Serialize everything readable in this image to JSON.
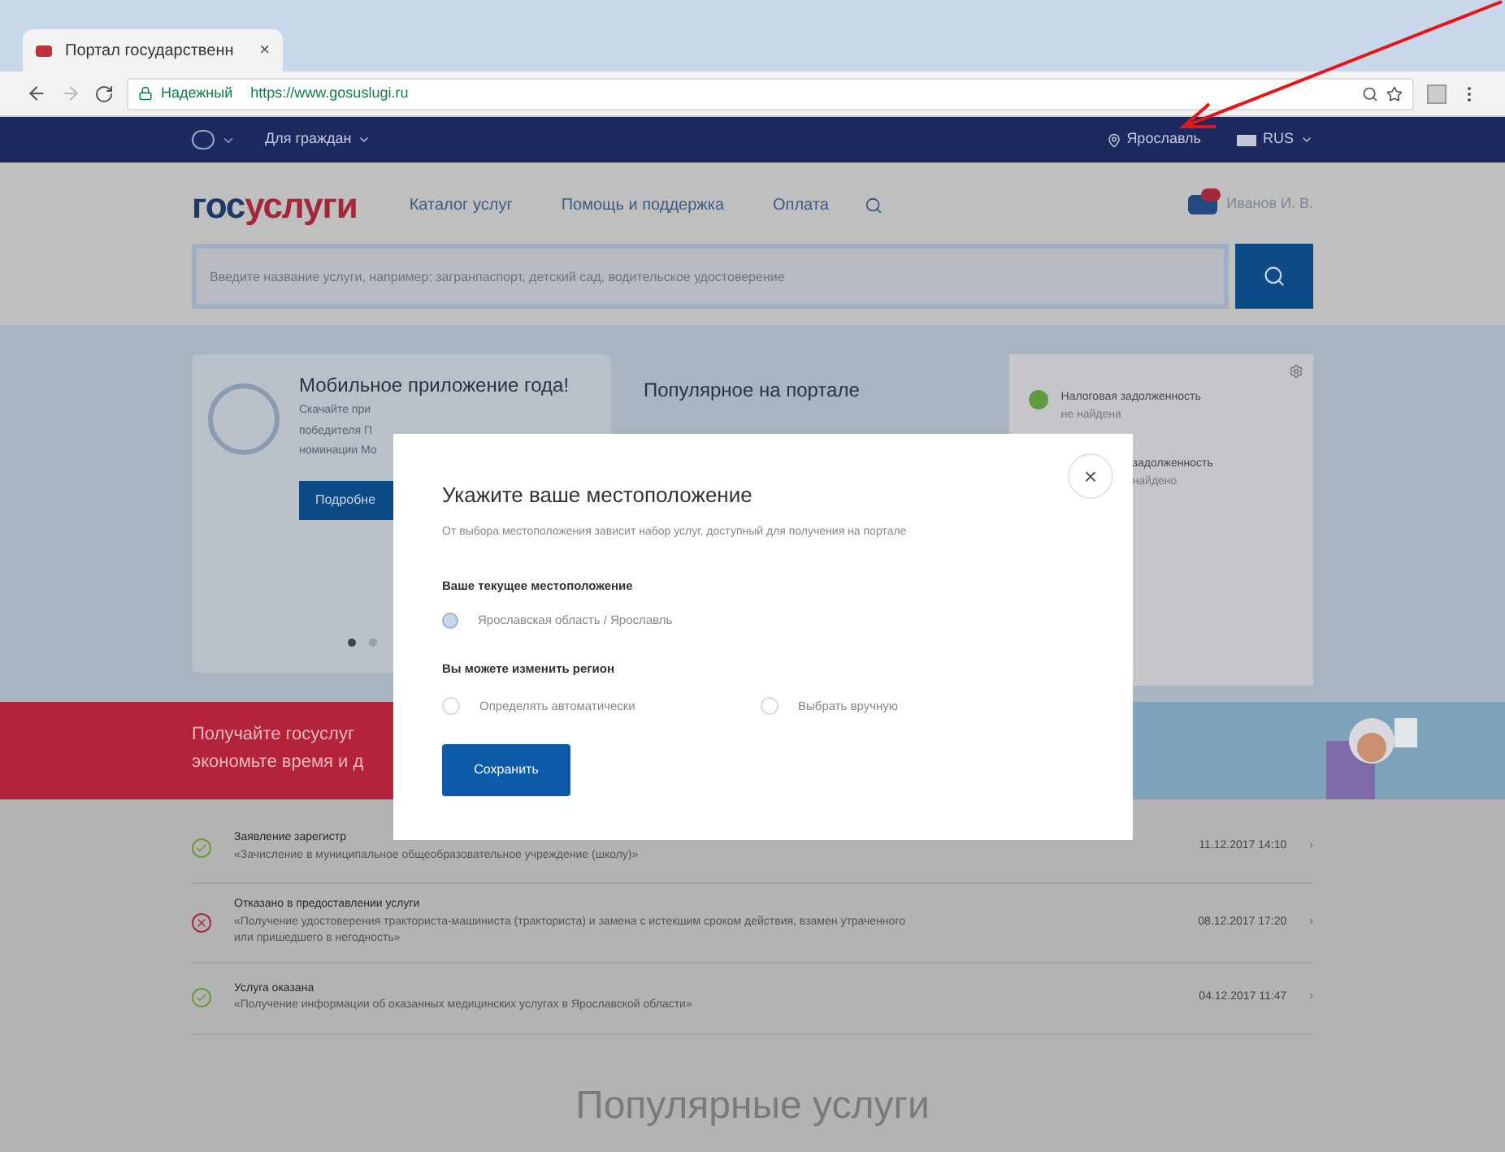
{
  "browser": {
    "tab_title": "Портал государственн",
    "tab_close": "×",
    "secure_label": "Надежный",
    "url": "https://www.gosuslugi.ru"
  },
  "topbar": {
    "audience": "Для граждан",
    "location": "Ярославль",
    "language": "RUS"
  },
  "header": {
    "logo_first": "гос",
    "logo_second": "услуги",
    "nav": [
      "Каталог услуг",
      "Помощь и поддержка",
      "Оплата"
    ],
    "user": "Иванов И. В."
  },
  "search": {
    "placeholder": "Введите название услуги, например: загранпаспорт, детский сад, водительское удостоверение"
  },
  "promo": {
    "title": "Мобильное приложение года!",
    "lines": [
      "Скачайте при",
      "победителя П",
      "номинации Мо"
    ],
    "button": "Подробне",
    "dots": [
      {
        "selected": true
      },
      {
        "selected": false
      }
    ]
  },
  "popular": {
    "title": "Популярное на портале"
  },
  "status_card": {
    "items": [
      {
        "kind": "ok",
        "text": "Налоговая задолженность",
        "sub": "не найдена"
      },
      {
        "kind": "plain",
        "text": "задолженность",
        "sub": "найдено"
      }
    ]
  },
  "banner": {
    "lines": [
      "Получайте госуслуг",
      "экономьте время и д"
    ]
  },
  "events": [
    {
      "kind": "ok",
      "title": "Заявление зарегистр",
      "subtitle": "«Зачисление в муниципальное общеобразовательное учреждение (школу)»",
      "date": "11.12.2017 14:10",
      "chevron": "›"
    },
    {
      "kind": "rejected",
      "title": "Отказано в предоставлении услуги",
      "subtitle": "«Получение удостоверения тракториста-машиниста (тракториста) и замена с истекшим сроком действия, взамен утраченного или пришедшего в негодность»",
      "date": "08.12.2017 17:20",
      "chevron": "›"
    },
    {
      "kind": "ok",
      "title": "Услуга оказана",
      "subtitle": "«Получение информации об оказанных медицинских услугах в Ярославской области»",
      "date": "04.12.2017 11:47",
      "chevron": "›"
    }
  ],
  "popular_services": {
    "title": "Популярные услуги"
  },
  "modal": {
    "title": "Укажите ваше местоположение",
    "subtitle": "От выбора местоположения зависит набор услуг, доступный для получения на портале",
    "current_label": "Ваше текущее местоположение",
    "current_value": "Ярославская область / Ярославль",
    "change_label": "Вы можете изменить регион",
    "options": [
      {
        "label": "Определять автоматически",
        "selected": false
      },
      {
        "label": "Выбрать вручную",
        "selected": false
      }
    ],
    "save": "Сохранить",
    "close": "×"
  }
}
